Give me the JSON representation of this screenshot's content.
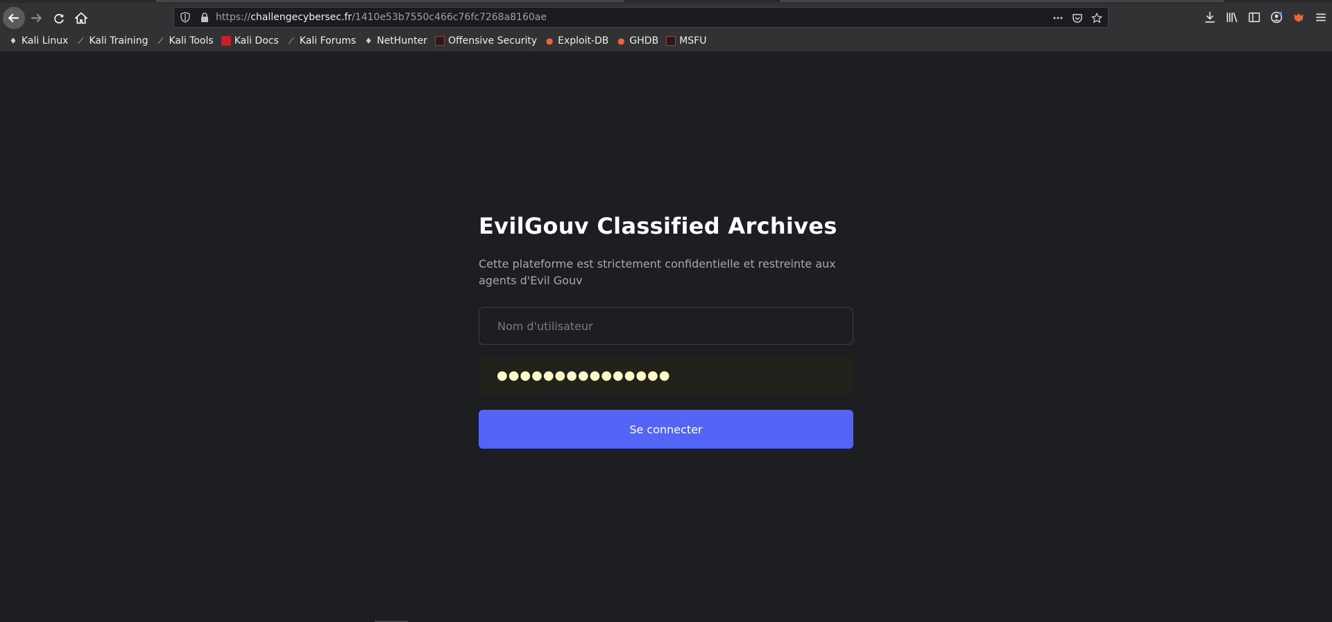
{
  "browser": {
    "url_prefix": "https://",
    "url_host": "challengecybersec.fr",
    "url_path": "/1410e53b7550c466c76fc7268a8160ae",
    "bookmarks": [
      {
        "label": "Kali Linux",
        "icon": "kali-dragon-icon"
      },
      {
        "label": "Kali Training",
        "icon": "kali-sword-icon"
      },
      {
        "label": "Kali Tools",
        "icon": "kali-sword-icon"
      },
      {
        "label": "Kali Docs",
        "icon": "kali-docs-icon"
      },
      {
        "label": "Kali Forums",
        "icon": "kali-sword-icon"
      },
      {
        "label": "NetHunter",
        "icon": "kali-dragon-icon"
      },
      {
        "label": "Offensive Security",
        "icon": "offsec-icon"
      },
      {
        "label": "Exploit-DB",
        "icon": "exploit-db-icon"
      },
      {
        "label": "GHDB",
        "icon": "ghdb-icon"
      },
      {
        "label": "MSFU",
        "icon": "msfu-icon"
      }
    ]
  },
  "login": {
    "title": "EvilGouv Classified Archives",
    "subtitle": "Cette plateforme est strictement confidentielle et restreinte aux agents d'Evil Gouv",
    "username_placeholder": "Nom d'utilisateur",
    "password_value": "●●●●●●●●●●●●●●●",
    "submit_label": "Se connecter"
  },
  "colors": {
    "background": "#1d1e22",
    "accent": "#5365f6",
    "autofill": "#fffbc8"
  }
}
